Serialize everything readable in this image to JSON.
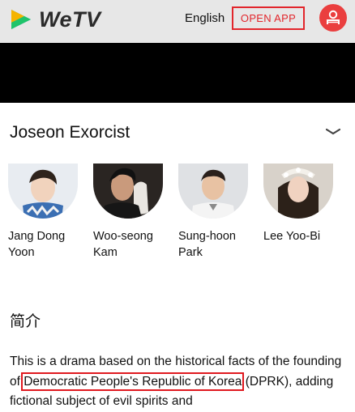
{
  "header": {
    "brand": "WeTV",
    "language": "English",
    "open_app_label": "OPEN APP"
  },
  "show": {
    "title": "Joseon Exorcist"
  },
  "cast": [
    {
      "name_line1": "Jang Dong",
      "name_line2": "Yoon"
    },
    {
      "name_line1": "Woo-seong",
      "name_line2": "Kam"
    },
    {
      "name_line1": "Sung-hoon",
      "name_line2": "Park"
    },
    {
      "name_line1": "Lee Yoo-Bi",
      "name_line2": ""
    }
  ],
  "intro": {
    "heading": "简介",
    "text_before": "This is a drama based on the historical facts of the founding of ",
    "highlight": "Democratic People's Republic of Korea",
    "text_after": " (DPRK), adding fictional subject of evil spirits and"
  },
  "colors": {
    "accent": "#e2262c",
    "topbar_bg": "#e7e7e7"
  },
  "icons": [
    "wetv-logo-icon",
    "user-icon",
    "chevron-down-icon"
  ]
}
